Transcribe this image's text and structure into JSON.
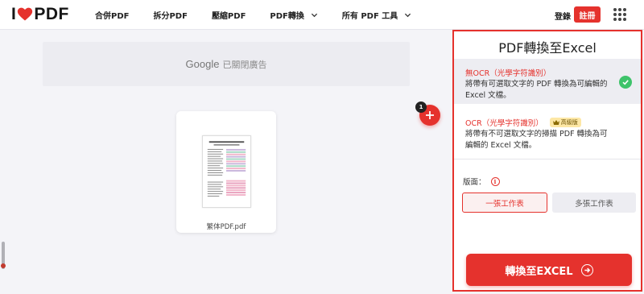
{
  "header": {
    "logo_left": "I",
    "logo_right": "PDF",
    "nav": [
      {
        "label": "合併PDF"
      },
      {
        "label": "拆分PDF"
      },
      {
        "label": "壓縮PDF"
      },
      {
        "label": "PDF轉換"
      },
      {
        "label": "所有 PDF 工具"
      }
    ],
    "login_label": "登錄",
    "register_label": "註冊"
  },
  "ad": {
    "google": "Google",
    "text": "已關閉廣告"
  },
  "file": {
    "name": "繁体PDF.pdf",
    "count_badge": "1"
  },
  "panel": {
    "title": "PDF轉換至Excel",
    "options": [
      {
        "title": "無OCR（光學字符識別）",
        "desc_line1": "將帶有可選取文字的 PDF 轉換為可編輯的",
        "desc_line2": "Excel 文檔。"
      },
      {
        "title": "OCR（光學字符識別）",
        "premium": "高級版",
        "desc_line1": "將帶有不可選取文字的掃描 PDF 轉換為可",
        "desc_line2": "編輯的 Excel 文檔。"
      }
    ],
    "layout_label": "版面：",
    "sheet_one": "一張工作表",
    "sheet_multi": "多張工作表",
    "convert_label": "轉換至EXCEL"
  },
  "colors": {
    "accent": "#e5322d",
    "success": "#3ec36a",
    "premium": "#fde7a5"
  }
}
